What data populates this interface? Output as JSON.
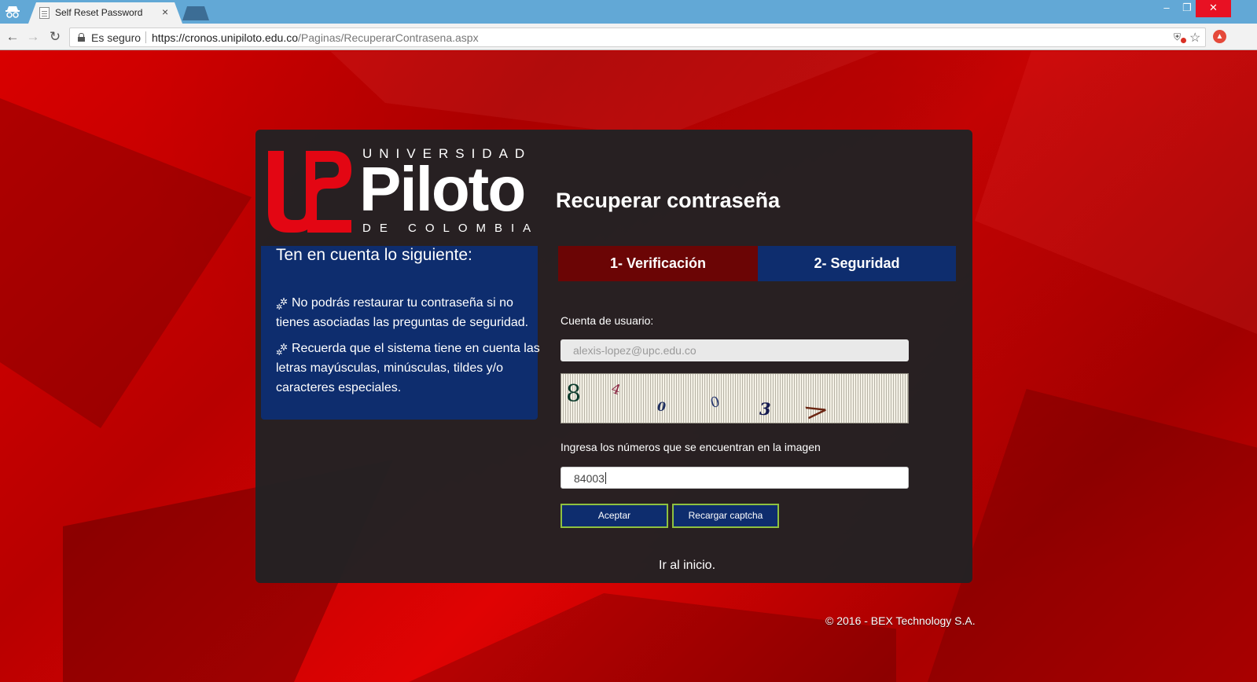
{
  "browser": {
    "tab_title": "Self Reset Password",
    "tab_close": "×",
    "secure_label": "Es seguro",
    "url_host": "https://cronos.unipiloto.edu.co",
    "url_path": "/Paginas/RecuperarContrasena.aspx",
    "icons": {
      "incognito": "incognito-icon",
      "back": "←",
      "forward": "→",
      "reload": "↻",
      "star": "☆",
      "minimize": "–",
      "maximize": "❐",
      "close": "✕"
    }
  },
  "logo": {
    "line1": "UNIVERSIDAD",
    "line2": "Piloto",
    "line3": "DE COLOMBIA",
    "brand_color": "#e30613"
  },
  "page": {
    "title": "Recuperar contraseña"
  },
  "info": {
    "heading": "Ten en cuenta lo siguiente:",
    "items": [
      "No podrás restaurar tu contraseña si no tienes asociadas las preguntas de seguridad.",
      "Recuerda que el sistema tiene en cuenta las letras mayúsculas, minúsculas, tildes y/o caracteres especiales."
    ]
  },
  "steps": [
    {
      "label": "1- Verificación",
      "active": true,
      "color": "#6b0505"
    },
    {
      "label": "2- Seguridad",
      "active": false,
      "color": "#0e2d6e"
    }
  ],
  "form": {
    "user_label": "Cuenta de usuario:",
    "user_value": "alexis-lopez@upc.edu.co",
    "captcha_chars": [
      "8",
      "4",
      "0",
      "0",
      "3",
      ">"
    ],
    "captcha_label": "Ingresa los números que se encuentran en la imagen",
    "captcha_value": "84003",
    "accept_label": "Aceptar",
    "reload_label": "Recargar captcha"
  },
  "home_link": "Ir al inicio.",
  "footer": "© 2016 - BEX Technology S.A."
}
